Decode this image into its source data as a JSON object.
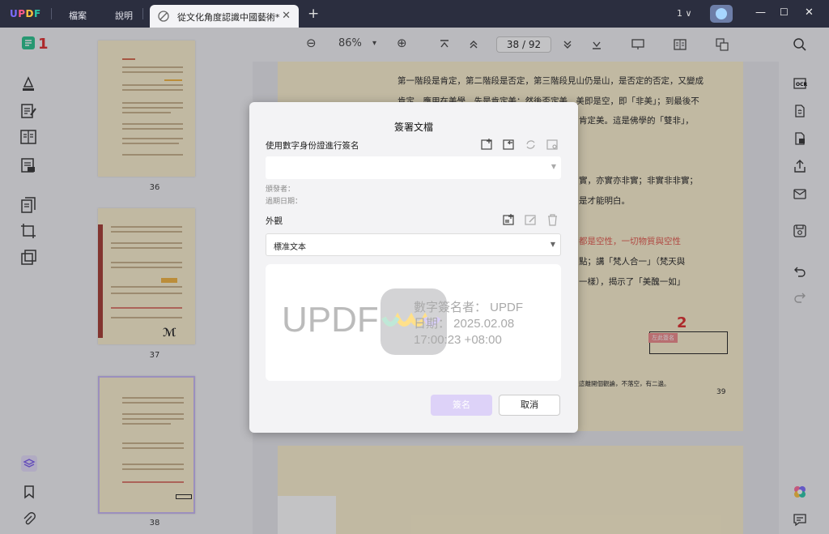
{
  "app": {
    "logo": "UPDF"
  },
  "menu": {
    "file": "檔案",
    "help": "說明"
  },
  "tab": {
    "title": "從文化角度認識中國藝術*",
    "close": "✕",
    "new": "+"
  },
  "titlebar": {
    "page_selector": "1 ∨",
    "minimize": "—",
    "maximize": "☐",
    "close": "✕"
  },
  "viewer": {
    "zoom_out": "⊖",
    "zoom": "86%",
    "zoom_dropdown": "▾",
    "zoom_in": "⊕",
    "current_page": "38",
    "page_sep": "/",
    "total_pages": "92"
  },
  "thumbnails": [
    {
      "number": "36"
    },
    {
      "number": "37"
    },
    {
      "number": "38"
    }
  ],
  "page": {
    "lines": [
      "第一階段是肯定，第二階段是否定，第三階段見山仍是山，是否定的否定，又變成",
      "肯定。應用在美學，先是肯定美；然後否定美，美即是空，即「非美」；到最後不",
      "肯定美。這是佛學的「雙非」，",
      "實，亦實亦非實；非實非非實；",
      "是才能明白。",
      "都是空性，一切物質與空性",
      "點；講「梵人合一」（梵天與",
      "一樣），揭示了「美醜一如」"
    ],
    "footnote": "這離開個觀論，不落空，有二邊。",
    "page_number": "39",
    "signature_field": "左此簽名"
  },
  "markers": {
    "one": "1",
    "two": "2"
  },
  "dialog": {
    "title": "簽署文檔",
    "digital_id_label": "使用數字身份證進行簽名",
    "issuer_label": "頒發者：",
    "expiry_label": "過期日期：",
    "appearance_label": "外觀",
    "appearance_value": "標准文本",
    "preview": {
      "name_text": "UPDF",
      "signer_line": "數字簽名者： UPDF",
      "date_line": "日期： 2025.02.08",
      "time_line": "17:00:23 +08:00"
    },
    "sign_button": "簽名",
    "cancel_button": "取消"
  }
}
